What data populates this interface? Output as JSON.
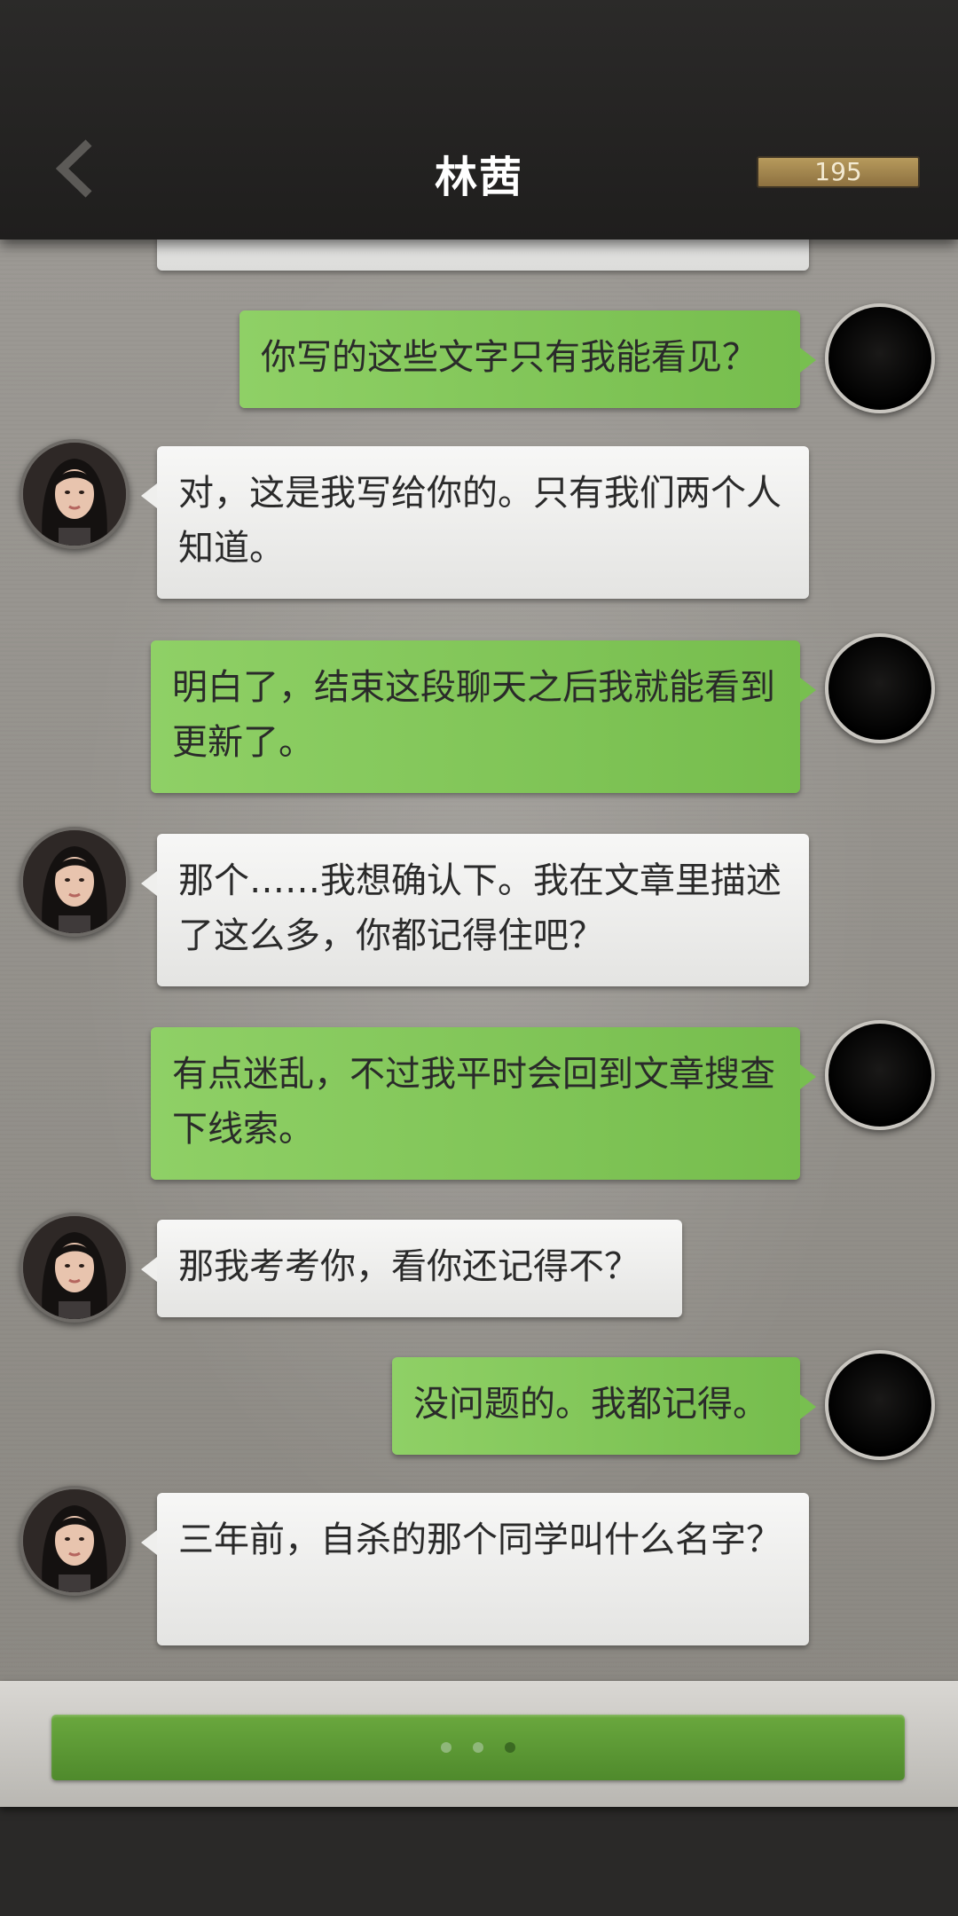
{
  "header": {
    "title": "林茜",
    "counter": "195",
    "back_icon": "chevron-left-icon"
  },
  "messages": [
    {
      "side": "right",
      "sender": "player",
      "text": "你写的这些文字只有我能看见？"
    },
    {
      "side": "left",
      "sender": "npc",
      "text": "对，这是我写给你的。只有我们两个人知道。"
    },
    {
      "side": "right",
      "sender": "player",
      "text": "明白了，结束这段聊天之后我就能看到更新了。"
    },
    {
      "side": "left",
      "sender": "npc",
      "text": "那个……我想确认下。我在文章里描述了这么多，你都记得住吧？"
    },
    {
      "side": "right",
      "sender": "player",
      "text": "有点迷乱，不过我平时会回到文章搜查下线索。"
    },
    {
      "side": "left",
      "sender": "npc",
      "text": "那我考考你，看你还记得不？"
    },
    {
      "side": "right",
      "sender": "player",
      "text": "没问题的。我都记得。"
    },
    {
      "side": "left",
      "sender": "npc",
      "text": "三年前，自杀的那个同学叫什么名字？"
    }
  ],
  "bottom": {
    "typing_indicator_dots": 3,
    "active_dot": 3
  },
  "colors": {
    "header_bg": "#232221",
    "player_bubble": "#82c75a",
    "npc_bubble": "#f0f0ee",
    "counter_bg": "#a68a52"
  }
}
